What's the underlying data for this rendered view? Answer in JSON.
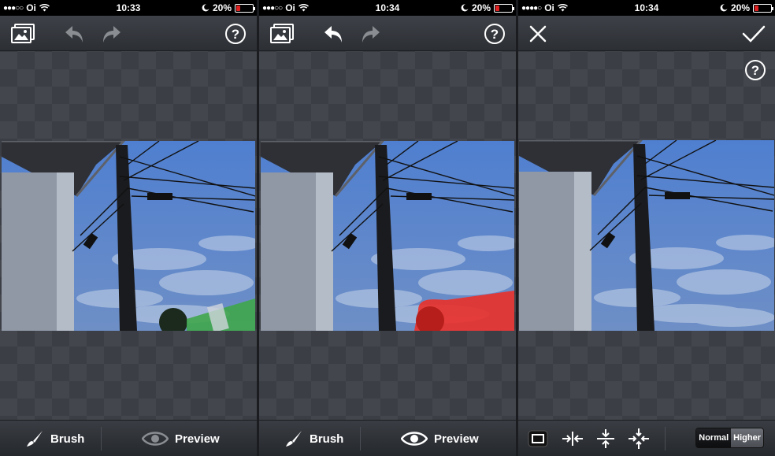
{
  "status": {
    "carrier": "Oi",
    "battery": "20%",
    "times": [
      "10:33",
      "10:34",
      "10:34"
    ]
  },
  "toolbar": {
    "brush_label": "Brush",
    "preview_label": "Preview"
  },
  "quality": {
    "normal_label": "Normal",
    "higher_label": "Higher"
  },
  "colors": {
    "battery_low": "#e02020",
    "selection_green": "#3fa64a",
    "selection_red": "#e8322c",
    "sky": "#5d86cf"
  }
}
